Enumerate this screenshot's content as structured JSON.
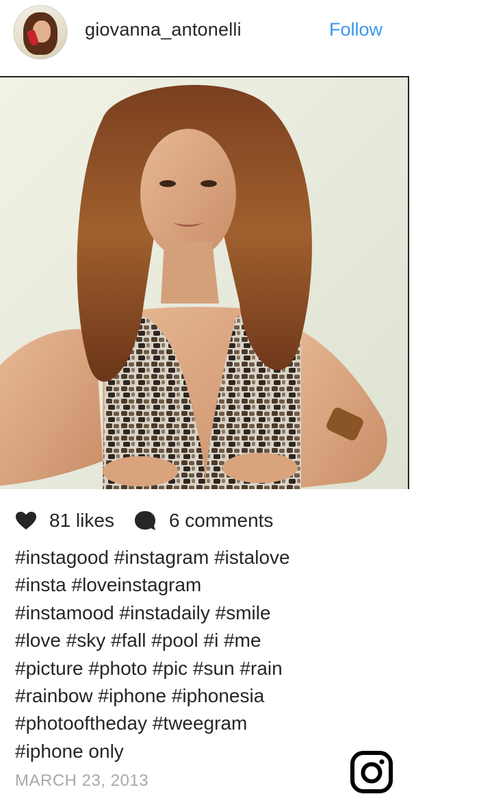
{
  "post": {
    "username": "giovanna_antonelli",
    "follow_label": "Follow",
    "likes": "81 likes",
    "comments": "6 comments",
    "caption_lines": [
      "#instagood #instagram #istalove",
      "#insta #loveinstagram",
      "#instamood #instadaily #smile",
      "#love #sky #fall #pool #i #me",
      "#picture #photo #pic #sun #rain",
      "#rainbow #iphone #iphonesia",
      "#photooftheday #tweegram",
      "#iphone only"
    ],
    "date": "MARCH 23, 2013"
  },
  "icons": {
    "like": "heart-icon",
    "comment": "comment-bubble-icon",
    "brand": "instagram-logo-icon"
  },
  "colors": {
    "text": "#262626",
    "follow": "#3897f0",
    "date": "#a8a8a8"
  }
}
